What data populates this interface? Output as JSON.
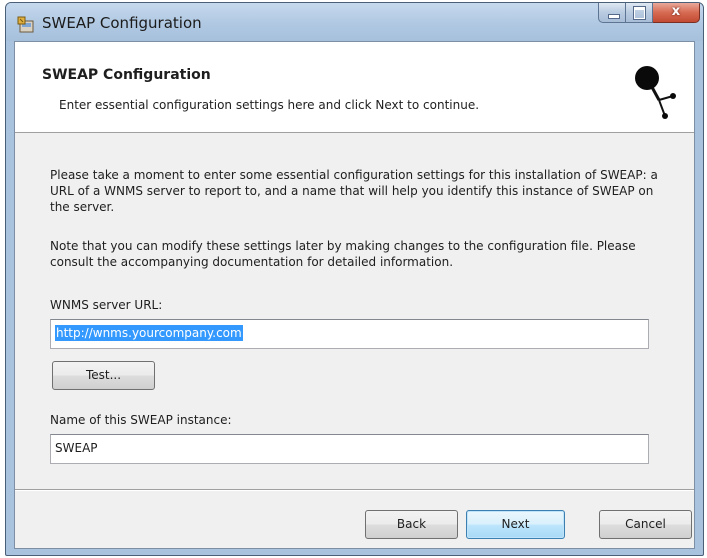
{
  "window": {
    "title": "SWEAP Configuration",
    "close_glyph": "x"
  },
  "banner": {
    "title": "SWEAP Configuration",
    "subtitle": "Enter essential configuration settings here and click Next to continue.",
    "logo_icon": "network-node-icon"
  },
  "content": {
    "paragraph1": "Please take a moment to enter some essential configuration settings for this installation of SWEAP: a URL of a WNMS server to report to, and a name that will help you identify this instance of SWEAP on the server.",
    "paragraph2": "Note that you can modify these settings later by making changes to the configuration file. Please consult the accompanying documentation for detailed information."
  },
  "form": {
    "url_label": "WNMS server URL:",
    "url_value": "http://wnms.yourcompany.com",
    "test_button": "Test...",
    "name_label": "Name of this SWEAP instance:",
    "name_value": "SWEAP"
  },
  "footer": {
    "back_button": "Back",
    "next_button": "Next",
    "cancel_button": "Cancel"
  },
  "colors": {
    "selection": "#3399ff",
    "default_button_border": "#3c7fb1",
    "close_button": "#c24a32"
  }
}
